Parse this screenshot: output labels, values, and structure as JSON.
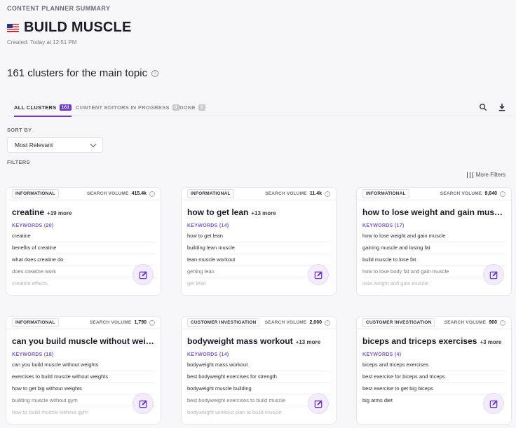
{
  "header": {
    "section_label": "CONTENT PLANNER SUMMARY",
    "title": "BUILD MUSCLE",
    "flag_icon": "us-flag-icon",
    "created": "Created: Today at 12:51 PM",
    "clusters_heading": "161 clusters for the main topic"
  },
  "tabs": [
    {
      "label": "ALL CLUSTERS",
      "count": "161",
      "active": true
    },
    {
      "label": "CONTENT EDITORS IN PROGRESS",
      "count": "0",
      "active": false
    },
    {
      "label": "DONE",
      "count": "0",
      "active": false
    }
  ],
  "tools": {
    "search_icon": "search-icon",
    "download_icon": "download-icon"
  },
  "sort": {
    "label": "SORT BY",
    "value": "Most Relevant"
  },
  "filters": {
    "label": "FILTERS",
    "more_filters": "More Filters"
  },
  "colors": {
    "accent": "#6c3ad1",
    "keywords_label": "#7b5bc7",
    "edit_bg": "#f3ecfd"
  },
  "cards": [
    {
      "intent": "INFORMATIONAL",
      "sv_label": "SEARCH VOLUME",
      "sv_value": "415.4k",
      "title": "creatine",
      "more": "+19 more",
      "keywords_label": "KEYWORDS (20)",
      "keywords": [
        "creatine",
        "benefits of creatine",
        "what does creatine do",
        "does creatine work",
        "creatine effects"
      ]
    },
    {
      "intent": "INFORMATIONAL",
      "sv_label": "SEARCH VOLUME",
      "sv_value": "11.4k",
      "title": "how to get lean",
      "more": "+13 more",
      "keywords_label": "KEYWORDS (14)",
      "keywords": [
        "how to get lean",
        "building lean muscle",
        "lean muscle workout",
        "getting lean",
        "get lean"
      ]
    },
    {
      "intent": "INFORMATIONAL",
      "sv_label": "SEARCH VOLUME",
      "sv_value": "9,640",
      "title": "how to lose weight and gain muscle...",
      "more": "",
      "keywords_label": "KEYWORDS (17)",
      "keywords": [
        "how to lose weight and gain muscle",
        "gaining muscle and losing fat",
        "build muscle to lose fat",
        "how to lose body fat and gain muscle",
        "lose weight and gain muscle"
      ]
    },
    {
      "intent": "INFORMATIONAL",
      "sv_label": "SEARCH VOLUME",
      "sv_value": "1,790",
      "title": "can you build muscle without weight...",
      "more": "",
      "keywords_label": "KEYWORDS (18)",
      "keywords": [
        "can you build muscle without weights",
        "exercises to build muscle without weights",
        "how to get big without weights",
        "building muscle without gym",
        "how to build muscle without gym"
      ]
    },
    {
      "intent": "CUSTOMER INVESTIGATION",
      "sv_label": "SEARCH VOLUME",
      "sv_value": "2,000",
      "title": "bodyweight mass workout",
      "more": "+13 more",
      "keywords_label": "KEYWORDS (14)",
      "keywords": [
        "bodyweight mass workout",
        "best bodyweight exercises for strength",
        "bodyweight muscle building",
        "best bodyweight exercises to build muscle",
        "bodyweight workout plan to build muscle"
      ]
    },
    {
      "intent": "CUSTOMER INVESTIGATION",
      "sv_label": "SEARCH VOLUME",
      "sv_value": "900",
      "title": "biceps and triceps exercises",
      "more": "+3 more",
      "keywords_label": "KEYWORDS (4)",
      "keywords": [
        "biceps and triceps exercises",
        "best exercise for biceps and triceps",
        "best exercise to get big biceps",
        "big arms diet"
      ]
    }
  ]
}
